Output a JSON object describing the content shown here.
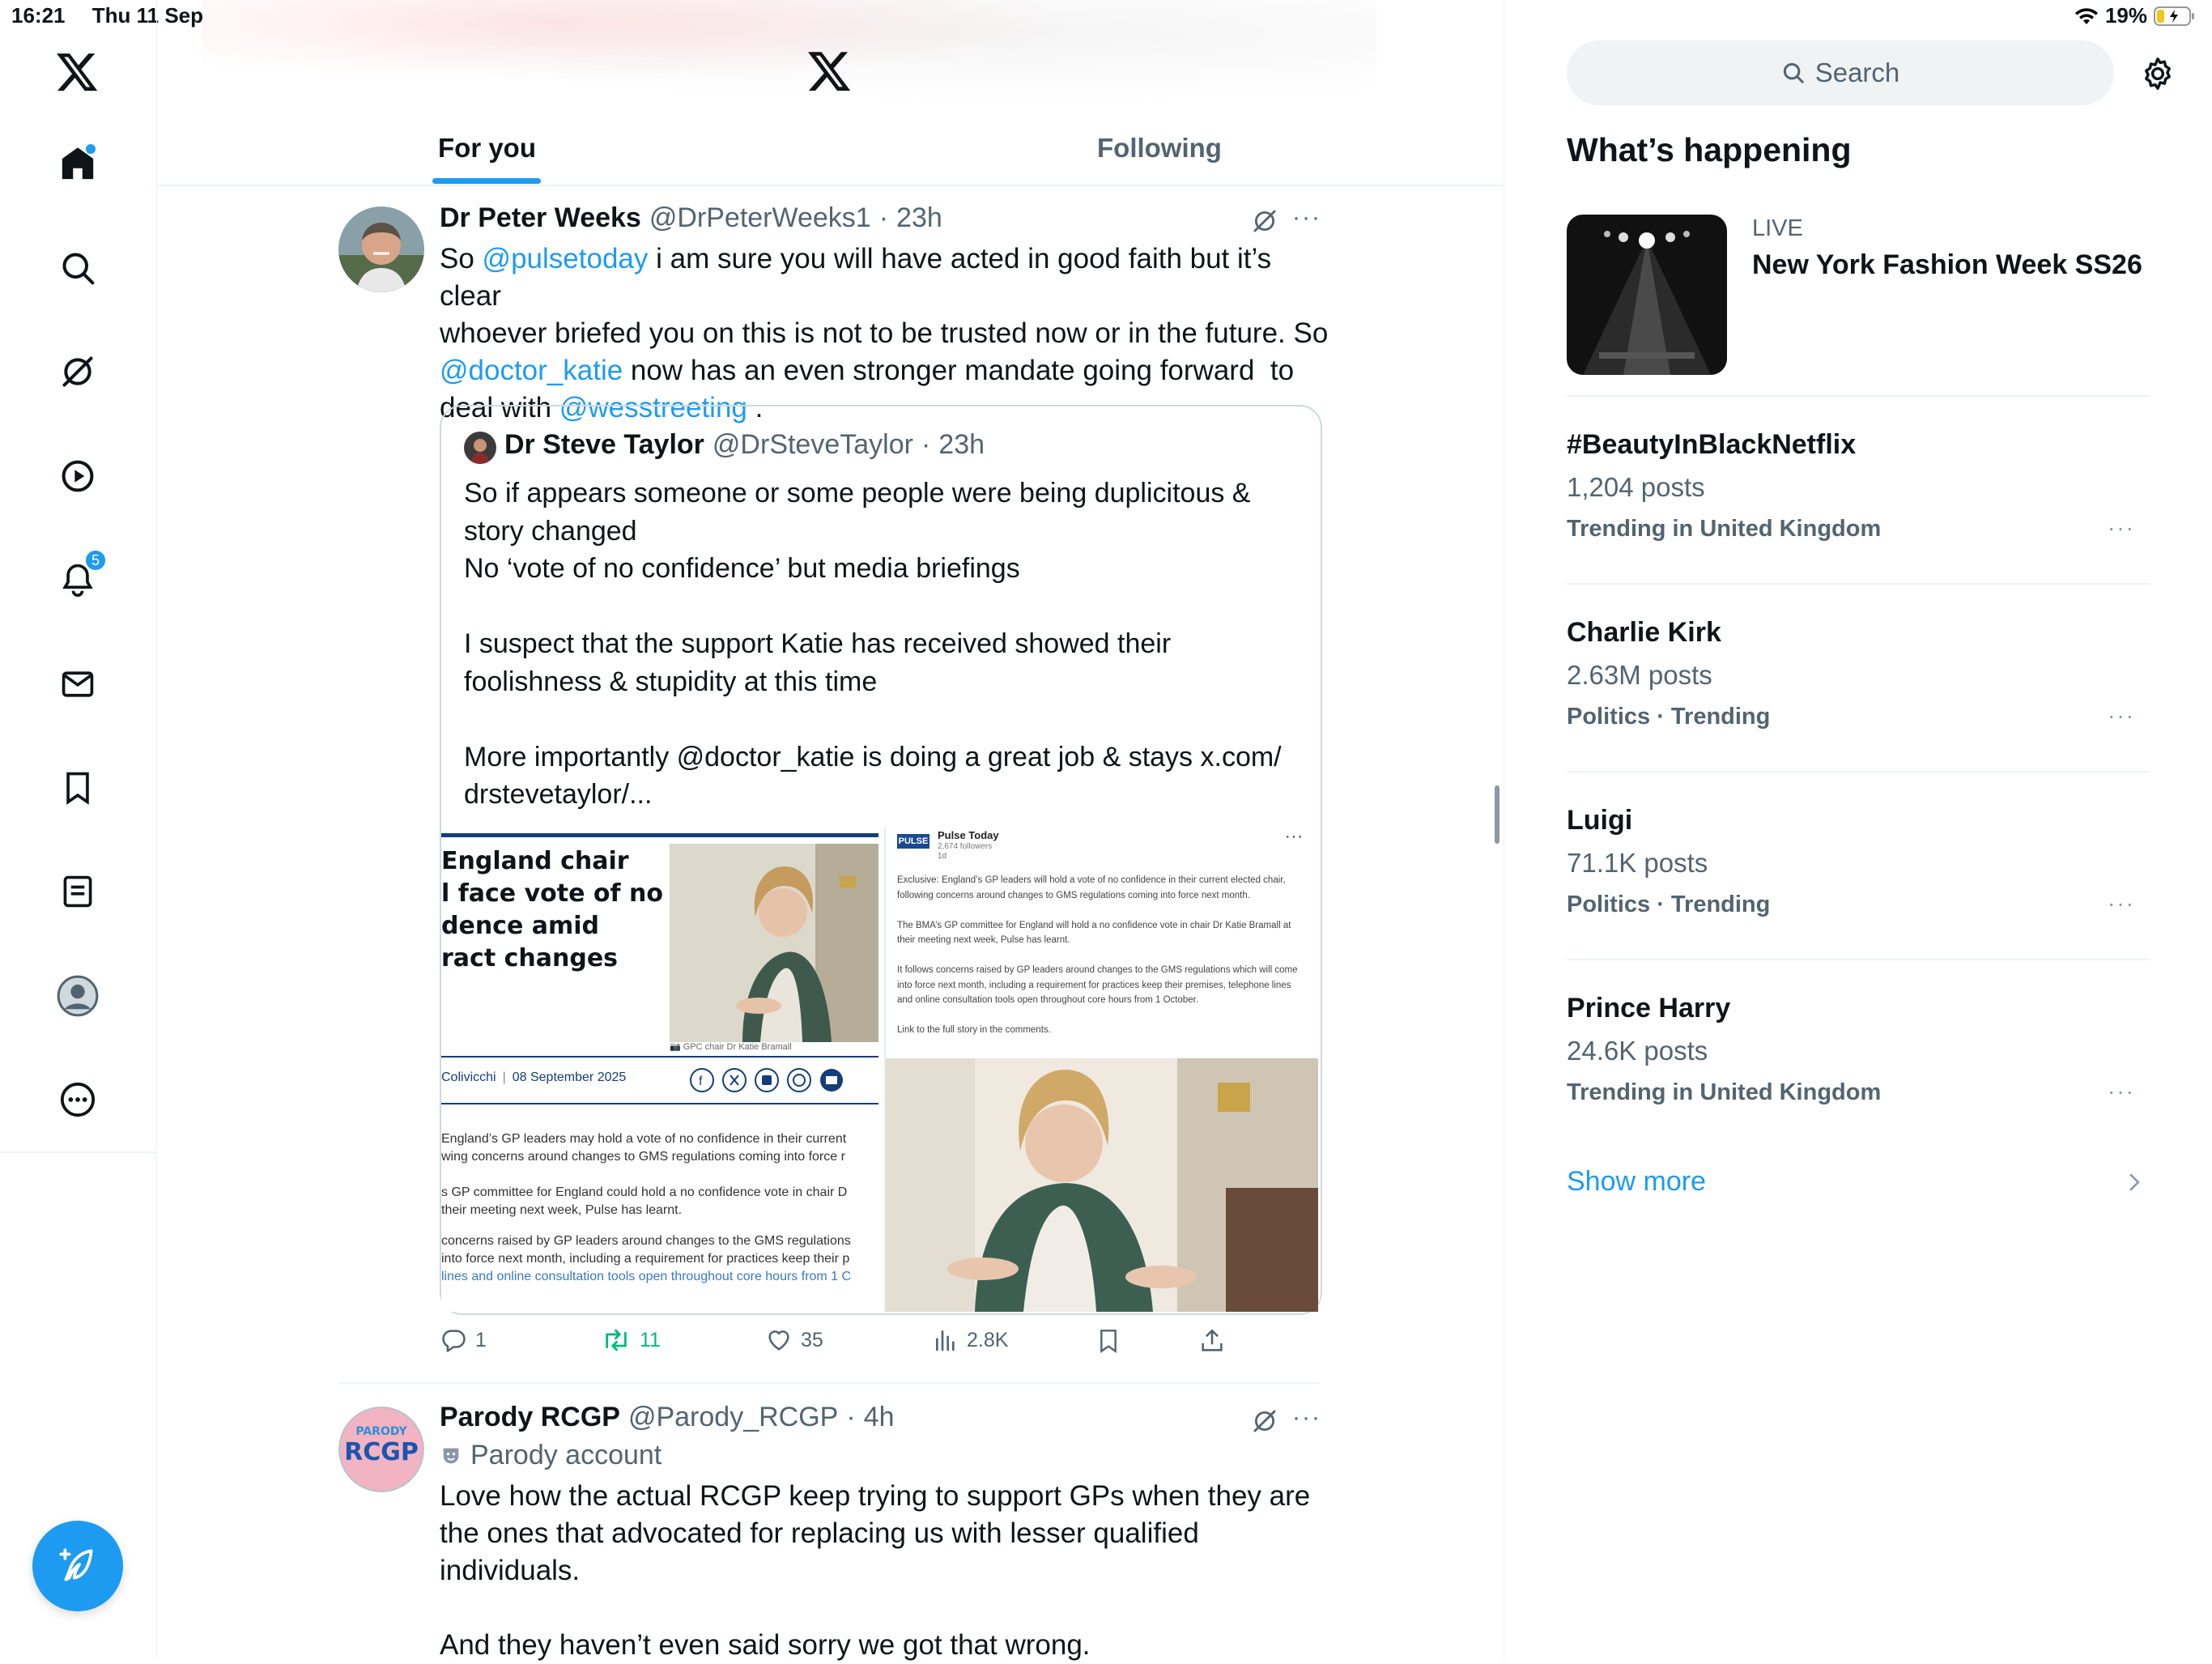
{
  "status": {
    "time": "16:21",
    "date": "Thu 11 Sep",
    "battery": "19%"
  },
  "nav": {
    "notifications_badge": "5"
  },
  "tabs": [
    {
      "label": "For you"
    },
    {
      "label": "Following"
    }
  ],
  "tweets": [
    {
      "name": "Dr Peter Weeks",
      "handle": "@DrPeterWeeks1",
      "time": "23h",
      "text_parts": [
        "So ",
        "@pulsetoday",
        " i am sure you will have acted in good faith but it’s clear",
        "whoever briefed you on this is not to be trusted now or in the future. So",
        "@doctor_katie",
        " now has an even stronger mandate going forward  to",
        "deal with ",
        "@wesstreeting",
        " ."
      ],
      "quote": {
        "name": "Dr Steve Taylor",
        "handle": "@DrSteveTaylor",
        "time": "23h",
        "text": "So if appears someone or some people were being duplicitous &\nstory changed\nNo ‘vote of no confidence’ but media briefings\n\nI suspect that the support Katie has received showed their\nfoolishness & stupidity at this time\n\nMore importantly @doctor_katie is doing a great job & stays x.com/\ndrstevetaylor/..."
      },
      "media": {
        "left_headline": [
          "England chair",
          "l face vote of no",
          "dence amid",
          "ract changes"
        ],
        "left_caption": "GPC chair Dr Katie Bramall",
        "left_byline_author": "Colivicchi",
        "left_byline_date": "08 September 2025",
        "left_body": [
          "England’s GP leaders may hold a vote of no confidence in their current",
          "wing concerns around changes to GMS regulations coming into force r",
          "",
          "s GP committee for England could hold a no confidence vote in chair D",
          " their meeting next week, Pulse has learnt.",
          "",
          "concerns raised by GP leaders around changes to the GMS regulations",
          "into force next month, including a requirement for practices keep their p",
          " lines and online consultation tools open throughout core hours from 1 C"
        ],
        "right_source": "Pulse Today",
        "right_followers": "2,674 followers",
        "right_age": "1d",
        "right_body": "Exclusive: England’s GP leaders will hold a vote of no confidence in their current elected chair, following concerns around changes to GMS regulations coming into force next month.\n\nThe BMA’s GP committee for England will hold a no confidence vote in chair Dr Katie Bramall at their meeting next week, Pulse has learnt.\n\nIt follows concerns raised by GP leaders around changes to the GMS regulations which will come into force next month, including a requirement for practices keep their premises, telephone lines and online consultation tools open throughout core hours from 1 October.\n\nLink to the full story in the comments."
      },
      "actions": {
        "replies": "1",
        "reposts": "11",
        "likes": "35",
        "views": "2.8K"
      }
    },
    {
      "name": "Parody RCGP",
      "handle": "@Parody_RCGP",
      "time": "4h",
      "label": "Parody account",
      "avatar_text": "RCGP",
      "avatar_small": "PARODY",
      "text": "Love how the actual RCGP keep trying to support GPs when they are\nthe ones that advocated for replacing us with lesser qualified\nindividuals.\n\nAnd they haven’t even said sorry we got that wrong."
    }
  ],
  "sidebar": {
    "search_placeholder": "Search",
    "section_title": "What’s happening",
    "live": {
      "tag": "LIVE",
      "title": "New York Fashion Week SS26"
    },
    "trends": [
      {
        "title": "#BeautyInBlackNetflix",
        "count": "1,204 posts",
        "meta": "Trending in United Kingdom"
      },
      {
        "title": "Charlie Kirk",
        "count": "2.63M posts",
        "meta": "Politics · Trending"
      },
      {
        "title": "Luigi",
        "count": "71.1K posts",
        "meta": "Politics · Trending"
      },
      {
        "title": "Prince Harry",
        "count": "24.6K posts",
        "meta": "Trending in United Kingdom"
      }
    ],
    "show_more": "Show more"
  }
}
